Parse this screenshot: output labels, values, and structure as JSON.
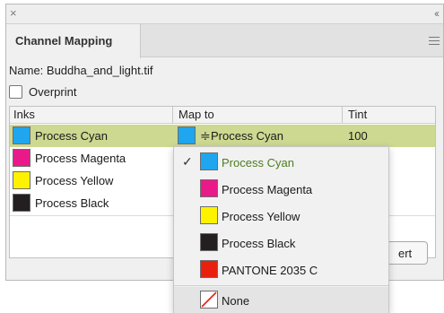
{
  "window": {
    "close_glyph": "×",
    "collapse_glyph": "‹‹",
    "tab_title": "Channel Mapping"
  },
  "name_line": "Name: Buddha_and_light.tif",
  "overprint": {
    "label": "Overprint",
    "checked": false
  },
  "table": {
    "headers": {
      "inks": "Inks",
      "map_to": "Map to",
      "tint": "Tint"
    },
    "rows": [
      {
        "ink": "Process Cyan",
        "color": "#1fa6ee",
        "map_to": "Process Cyan",
        "map_color": "#1fa6ee",
        "tint": "100",
        "selected": true
      },
      {
        "ink": "Process Magenta",
        "color": "#ea198a",
        "selected": false
      },
      {
        "ink": "Process Yellow",
        "color": "#fff200",
        "selected": false
      },
      {
        "ink": "Process Black",
        "color": "#231f20",
        "selected": false
      }
    ],
    "map_arrows": "≑"
  },
  "buttons": {
    "revert_partial": "ert"
  },
  "dropdown": {
    "check_glyph": "✓",
    "items": [
      {
        "label": "Process Cyan",
        "color": "#1fa6ee",
        "checked": true
      },
      {
        "label": "Process Magenta",
        "color": "#ea198a"
      },
      {
        "label": "Process Yellow",
        "color": "#fff200"
      },
      {
        "label": "Process Black",
        "color": "#231f20"
      },
      {
        "label": "PANTONE 2035 C",
        "color": "#e8210e"
      }
    ],
    "none_label": "None"
  },
  "colors": {
    "selection": "#cdd891",
    "checked_text": "#4d7d1f"
  }
}
